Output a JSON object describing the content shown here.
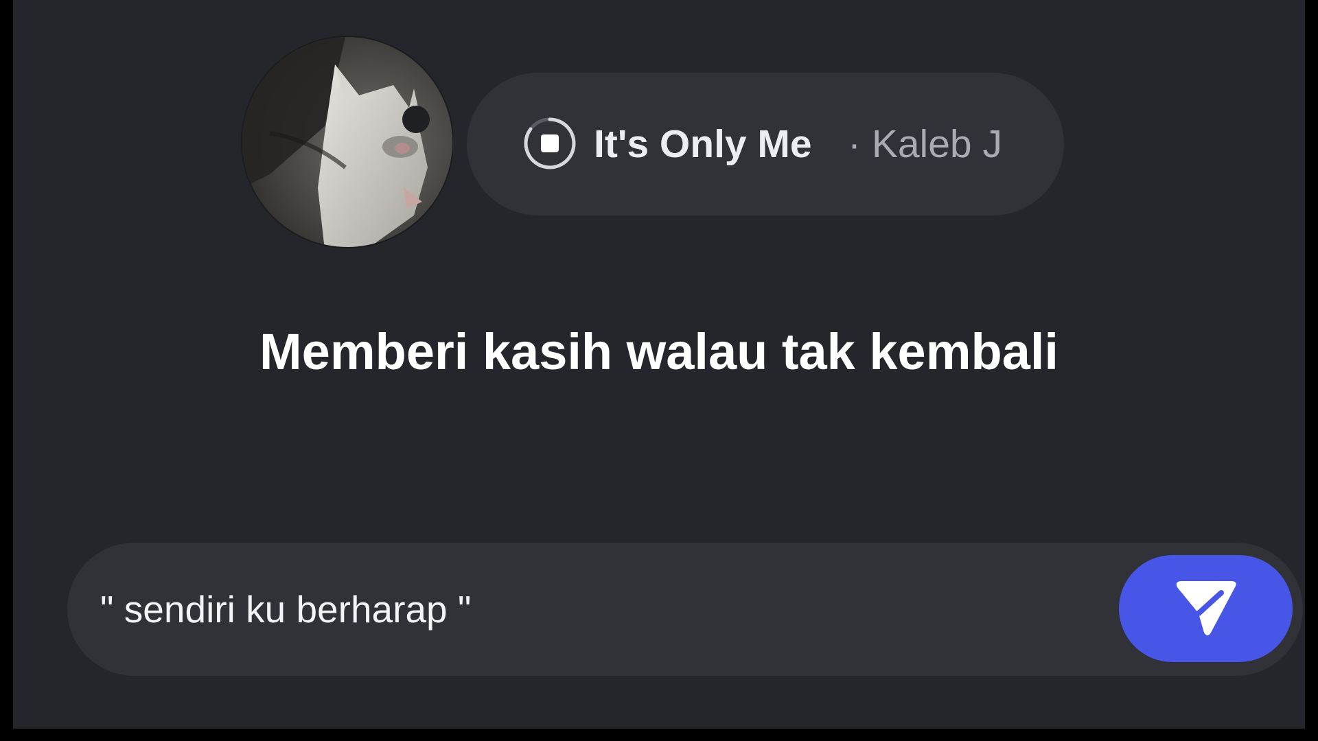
{
  "now_playing": {
    "title": "It's Only Me",
    "artist": "· Kaleb J",
    "status_icon": "stop-icon"
  },
  "lyric": {
    "text": "Memberi kasih walau tak kembali"
  },
  "reply": {
    "value": "\" sendiri ku berharap \"",
    "send_icon": "send-icon"
  },
  "colors": {
    "background": "#25262b",
    "pill": "#313238",
    "accent": "#4856e8",
    "text_primary": "#ffffff",
    "text_secondary": "#a9abb3"
  }
}
